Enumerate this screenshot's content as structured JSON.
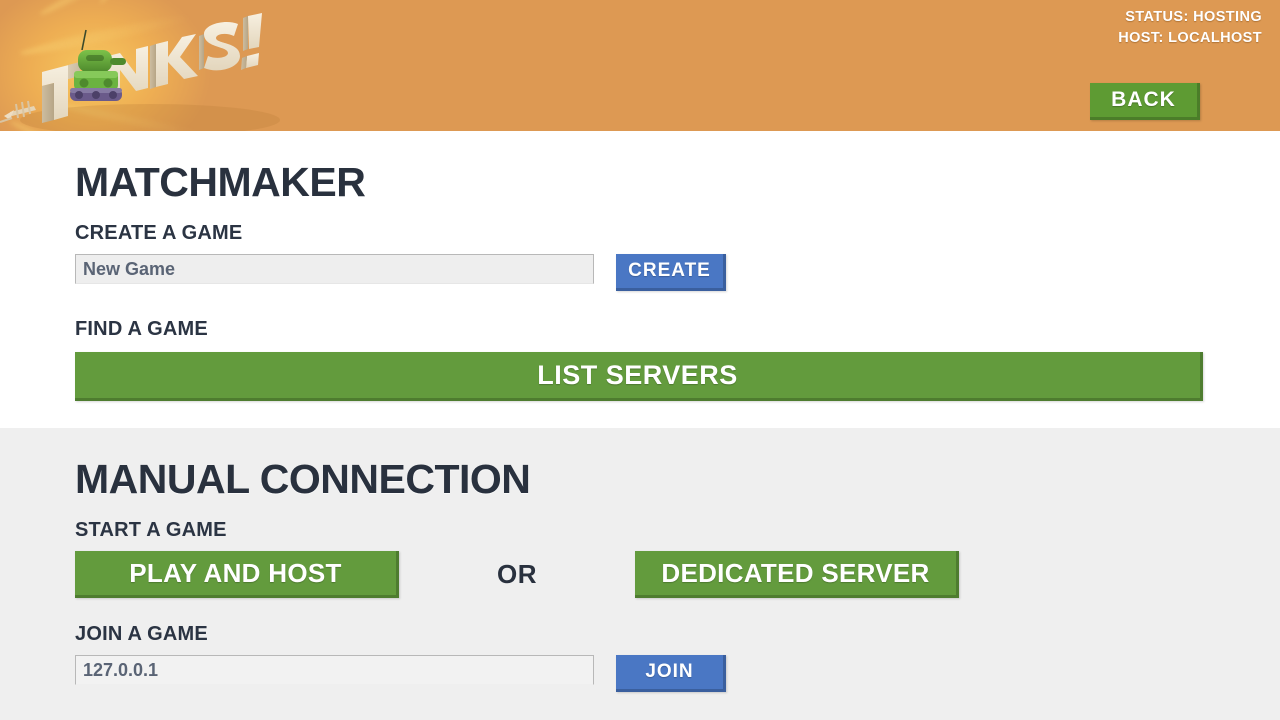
{
  "header": {
    "logo_alt": "TANKS!",
    "logo_word": "TANKS!",
    "status_line_1": "STATUS: HOSTING",
    "status_line_2": "HOST: LOCALHOST",
    "back_label": "BACK",
    "colors": {
      "header_bg": "#dd9953",
      "logo_glow": "#f7c85e",
      "tank_green": "#5aa03a",
      "letter_beige": "#efe3cd"
    }
  },
  "matchmaker": {
    "title": "MATCHMAKER",
    "create": {
      "label": "CREATE A GAME",
      "input_value": "New Game",
      "input_placeholder": "New Game",
      "button_label": "CREATE"
    },
    "find": {
      "label": "FIND A GAME",
      "button_label": "LIST SERVERS"
    }
  },
  "manual_connection": {
    "title": "MANUAL CONNECTION",
    "start": {
      "label": "START A GAME",
      "host_button_label": "PLAY AND HOST",
      "or_label": "OR",
      "dedicated_button_label": "DEDICATED SERVER"
    },
    "join": {
      "label": "JOIN A GAME",
      "input_value": "127.0.0.1",
      "input_placeholder": "127.0.0.1",
      "button_label": "JOIN"
    }
  },
  "theme": {
    "green": "#639b3d",
    "blue": "#4a77c4",
    "navy": "#29313e",
    "orange": "#dd9953",
    "gray_section": "#efefef"
  }
}
